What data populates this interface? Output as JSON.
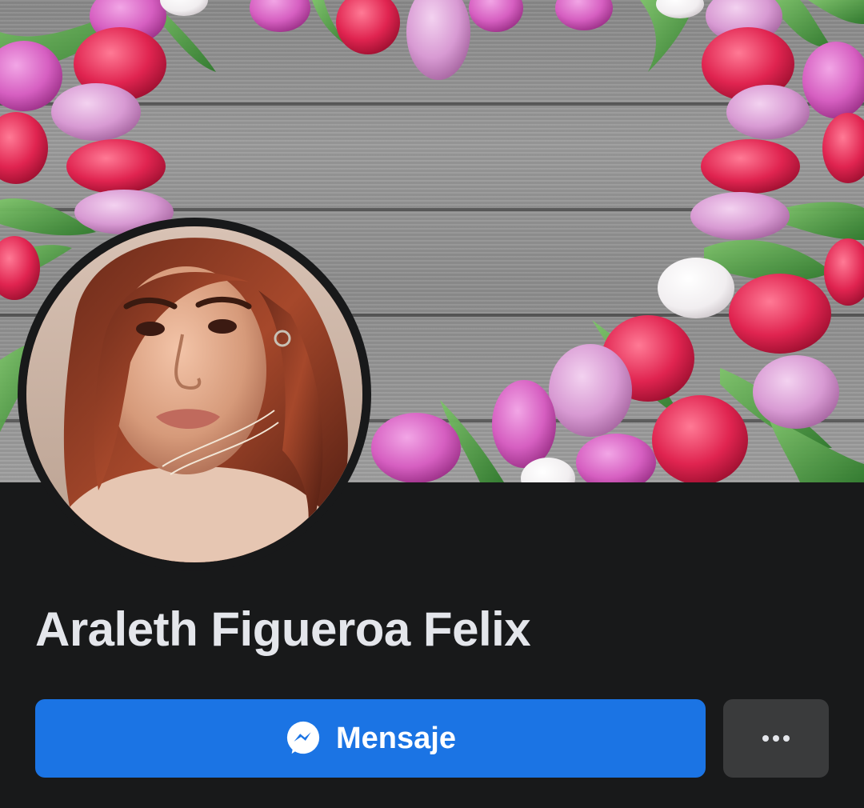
{
  "profile": {
    "name": "Araleth Figueroa Felix"
  },
  "actions": {
    "message_label": "Mensaje",
    "message_icon": "messenger-icon",
    "more_icon": "more-horizontal-icon"
  },
  "colors": {
    "background": "#18191a",
    "primary_button": "#1b74e4",
    "secondary_button": "#3a3b3c",
    "text": "#e4e6eb"
  }
}
